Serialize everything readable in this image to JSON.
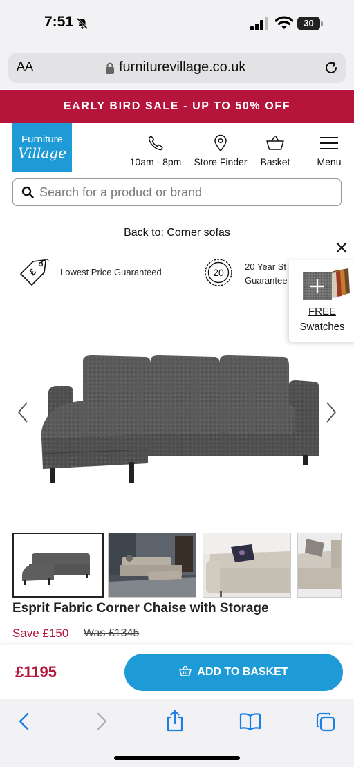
{
  "status_bar": {
    "time": "7:51",
    "battery": "30"
  },
  "browser": {
    "aa_label": "AA",
    "url": "furniturevillage.co.uk"
  },
  "promo": {
    "text": "EARLY BIRD SALE - UP TO 50% OFF"
  },
  "logo": {
    "line1": "Furniture",
    "line2": "Village"
  },
  "header_nav": {
    "phone": "10am - 8pm",
    "store": "Store Finder",
    "basket": "Basket",
    "menu": "Menu"
  },
  "search": {
    "placeholder": "Search for a product or brand"
  },
  "back_link": "Back to: Corner sofas",
  "guarantees": {
    "price": "Lowest Price Guaranteed",
    "badge": "20",
    "year_line1": "20 Year St",
    "year_line2": "Guarantee"
  },
  "swatches": {
    "line1": "FREE",
    "line2": "Swatches"
  },
  "product": {
    "title": "Esprit Fabric Corner Chaise with Storage",
    "save": "Save £150",
    "was": "Was £1345",
    "price": "£1195",
    "add_to_basket": "ADD TO BASKET"
  },
  "colors": {
    "brand_red": "#b5153a",
    "brand_blue": "#1e9ad6"
  }
}
